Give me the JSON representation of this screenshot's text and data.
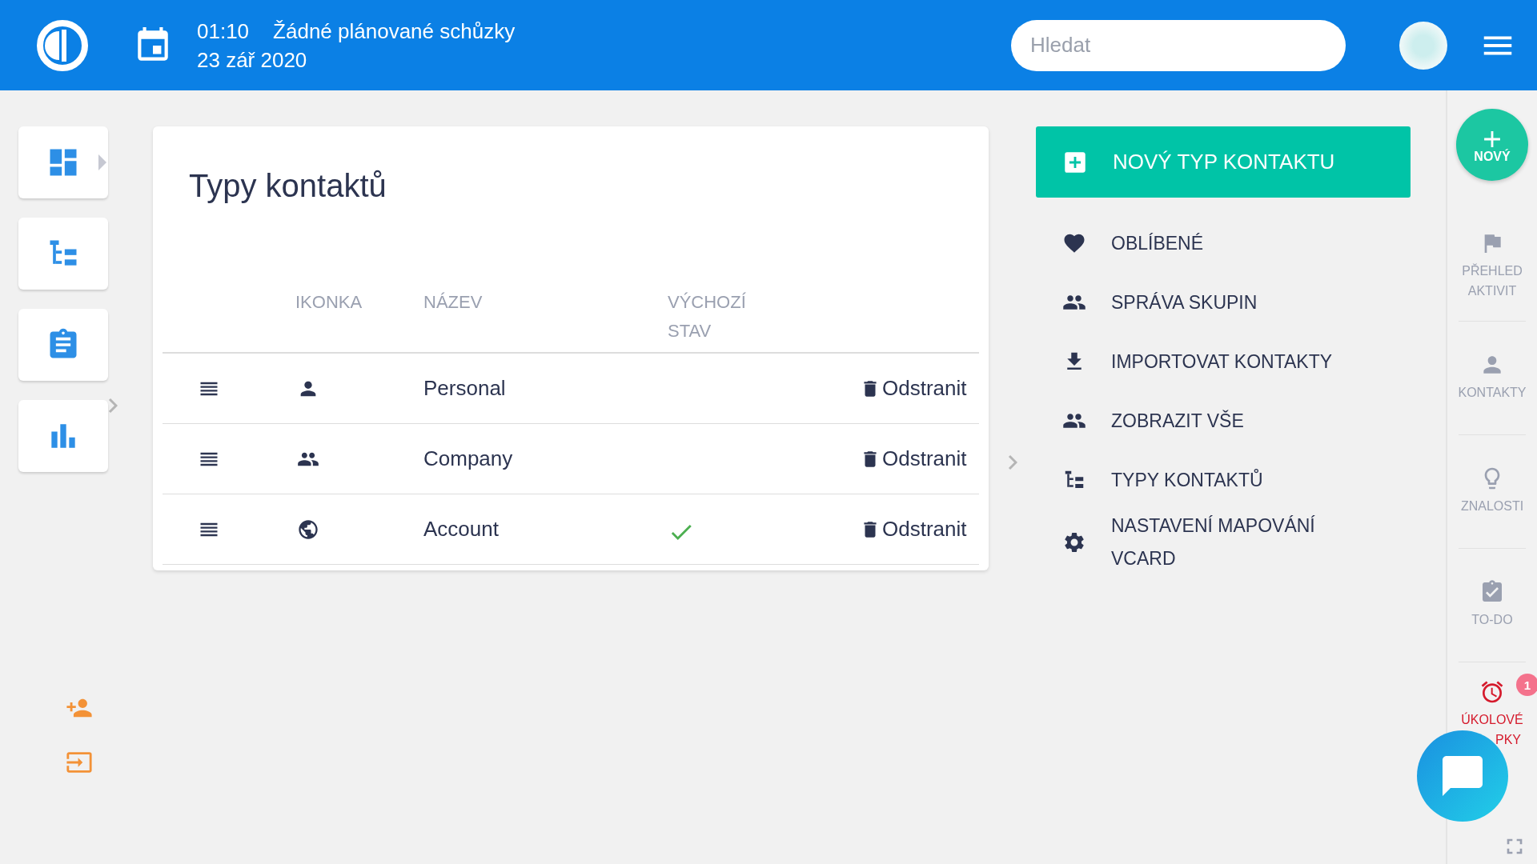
{
  "header": {
    "time": "01:10",
    "meeting": "Žádné plánované schůzky",
    "date": "23 zář 2020",
    "search": {
      "placeholder": "Hledat"
    }
  },
  "left_nav": [
    {
      "kind": "dashboard",
      "expanded": true
    },
    {
      "kind": "tree",
      "expanded": false
    },
    {
      "kind": "clipboard",
      "expanded": false
    },
    {
      "kind": "chart",
      "expanded": false
    }
  ],
  "left_tools": [
    {
      "kind": "person-add"
    },
    {
      "kind": "login"
    }
  ],
  "card": {
    "title": "Typy kontaktů",
    "columns": [
      "IKONKA",
      "NÁZEV",
      "VÝCHOZÍ STAV"
    ],
    "rows": [
      {
        "kind": "person",
        "name": "Personal",
        "default": false,
        "action": "Odstranit"
      },
      {
        "kind": "group",
        "name": "Company",
        "default": false,
        "action": "Odstranit"
      },
      {
        "kind": "globe",
        "name": "Account",
        "default": true,
        "action": "Odstranit"
      }
    ]
  },
  "actions": {
    "primary": "NOVÝ TYP KONTAKTU",
    "items": [
      {
        "kind": "heart",
        "label": "OBLÍBENÉ"
      },
      {
        "kind": "group",
        "label": "SPRÁVA SKUPIN"
      },
      {
        "kind": "download",
        "label": "IMPORTOVAT KONTAKTY"
      },
      {
        "kind": "group",
        "label": "ZOBRAZIT VŠE"
      },
      {
        "kind": "tree",
        "label": "TYPY KONTAKTŮ"
      },
      {
        "kind": "gear",
        "label": "NASTAVENÍ MAPOVÁNÍ VCARD"
      }
    ]
  },
  "right_rail": {
    "new_label": "NOVÝ",
    "items": [
      {
        "kind": "flag",
        "lines": [
          "PŘEHLED",
          "AKTIVIT"
        ],
        "alert": false
      },
      {
        "kind": "person",
        "lines": [
          "KONTAKTY"
        ],
        "alert": false
      },
      {
        "kind": "bulb",
        "lines": [
          "ZNALOSTI"
        ],
        "alert": false
      },
      {
        "kind": "todo",
        "lines": [
          "TO-DO"
        ],
        "alert": false
      },
      {
        "kind": "alarm",
        "lines": [
          "ÚKOLOVÉ",
          "PKY"
        ],
        "alert": true,
        "badge": "1"
      }
    ]
  }
}
